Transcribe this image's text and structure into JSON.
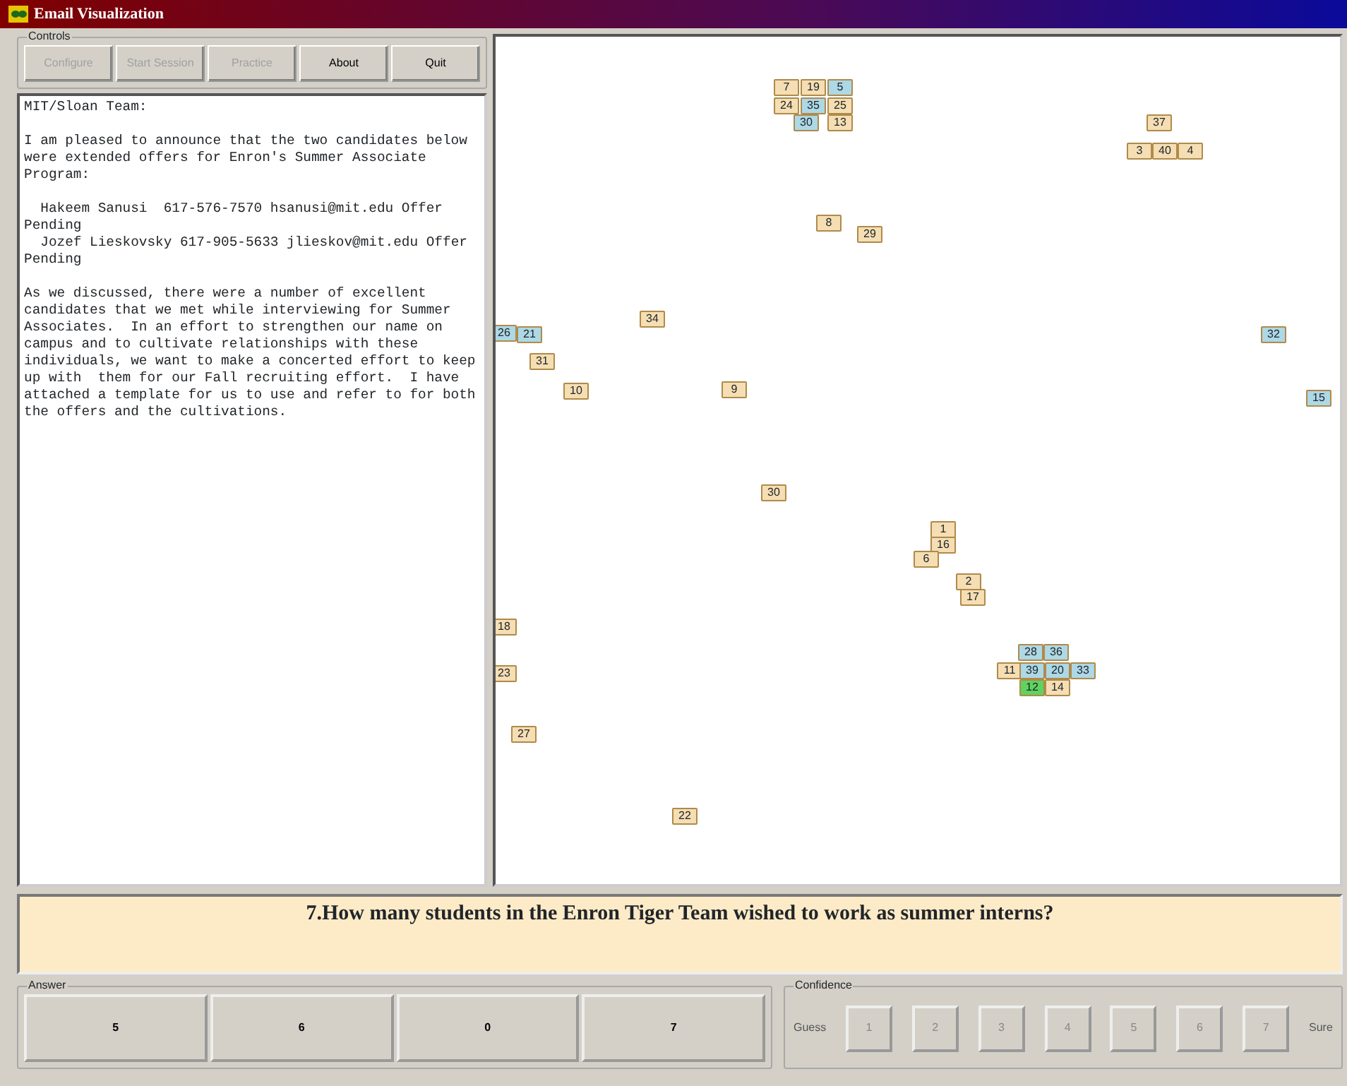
{
  "window": {
    "title": "Email Visualization"
  },
  "controls": {
    "legend": "Controls",
    "buttons": [
      {
        "label": "Configure",
        "disabled": true
      },
      {
        "label": "Start Session",
        "disabled": true
      },
      {
        "label": "Practice",
        "disabled": true
      },
      {
        "label": "About",
        "disabled": false
      },
      {
        "label": "Quit",
        "disabled": false
      }
    ]
  },
  "email": {
    "paragraphs": [
      "MIT/Sloan Team:",
      "I am pleased to announce that the two candidates below were extended offers for Enron's Summer Associate Program:",
      "  Hakeem Sanusi  617-576-7570 hsanusi@mit.edu Offer Pending",
      "  Jozef Lieskovsky 617-905-5633 jlieskov@mit.edu Offer Pending",
      "As we discussed, there were a number of excellent candidates that we met while interviewing for Summer Associates.  In an effort to strengthen our name on campus and to cultivate relationships with these individuals, we want to make a concerted effort to keep up with  them for our Fall recruiting effort.  I have attached a template for us to use and refer to for both the offers and the cultivations."
    ]
  },
  "nodes": [
    {
      "label": "7",
      "color": "#f5deb3"
    },
    {
      "label": "19",
      "color": "#f5deb3"
    },
    {
      "label": "5",
      "color": "#add8e6"
    },
    {
      "label": "24",
      "color": "#f5deb3"
    },
    {
      "label": "35",
      "color": "#add8e6"
    },
    {
      "label": "25",
      "color": "#f5deb3"
    },
    {
      "label": "30",
      "color": "#add8e6"
    },
    {
      "label": "13",
      "color": "#f5deb3"
    },
    {
      "label": "37",
      "color": "#f5deb3"
    },
    {
      "label": "3",
      "color": "#f5deb3"
    },
    {
      "label": "40",
      "color": "#f5deb3"
    },
    {
      "label": "4",
      "color": "#f5deb3"
    },
    {
      "label": "8",
      "color": "#f5deb3"
    },
    {
      "label": "29",
      "color": "#f5deb3"
    },
    {
      "label": "34",
      "color": "#f5deb3"
    },
    {
      "label": "26",
      "color": "#add8e6"
    },
    {
      "label": "21",
      "color": "#add8e6"
    },
    {
      "label": "32",
      "color": "#add8e6"
    },
    {
      "label": "31",
      "color": "#f5deb3"
    },
    {
      "label": "10",
      "color": "#f5deb3"
    },
    {
      "label": "9",
      "color": "#f5deb3"
    },
    {
      "label": "15",
      "color": "#add8e6"
    },
    {
      "label": "30",
      "color": "#f5deb3"
    },
    {
      "label": "1",
      "color": "#f5deb3"
    },
    {
      "label": "16",
      "color": "#f5deb3"
    },
    {
      "label": "6",
      "color": "#f5deb3"
    },
    {
      "label": "2",
      "color": "#f5deb3"
    },
    {
      "label": "17",
      "color": "#f5deb3"
    },
    {
      "label": "28",
      "color": "#add8e6"
    },
    {
      "label": "36",
      "color": "#add8e6"
    },
    {
      "label": "11",
      "color": "#f5deb3"
    },
    {
      "label": "39",
      "color": "#add8e6"
    },
    {
      "label": "20",
      "color": "#add8e6"
    },
    {
      "label": "33",
      "color": "#add8e6"
    },
    {
      "label": "12",
      "color": "#5fd35f"
    },
    {
      "label": "14",
      "color": "#f5deb3"
    },
    {
      "label": "18",
      "color": "#f5deb3"
    },
    {
      "label": "23",
      "color": "#f5deb3"
    },
    {
      "label": "27",
      "color": "#f5deb3"
    },
    {
      "label": "22",
      "color": "#f5deb3"
    }
  ],
  "question": "7.How many students in the Enron Tiger Team wished to work as summer interns?",
  "answer": {
    "legend": "Answer",
    "options": [
      "5",
      "6",
      "0",
      "7"
    ]
  },
  "confidence": {
    "legend": "Confidence",
    "low_label": "Guess",
    "levels": [
      "1",
      "2",
      "3",
      "4",
      "5",
      "6",
      "7"
    ],
    "high_label": "Sure"
  }
}
